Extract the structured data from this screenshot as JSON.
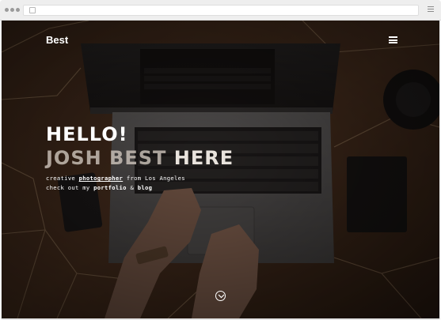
{
  "browser": {
    "menu_icon": "hamburger-icon",
    "address_icon": "page-icon"
  },
  "site": {
    "brand": "Best",
    "menu_icon": "hamburger-icon"
  },
  "hero": {
    "line1": "HELLO!",
    "line2_muted": "JOSH BEST",
    "line2_bright": "HERE",
    "sub_prefix": "creative ",
    "sub_link": "photographer",
    "sub_suffix": " from Los Angeles",
    "sub2_prefix": "check out my ",
    "portfolio": "portfolio",
    "and": " & ",
    "blog": "blog",
    "scroll_icon": "chevron-down-icon"
  },
  "colors": {
    "overlay": "#1e140e",
    "wood": "#5a3a25",
    "inlay": "#c9a37a"
  }
}
